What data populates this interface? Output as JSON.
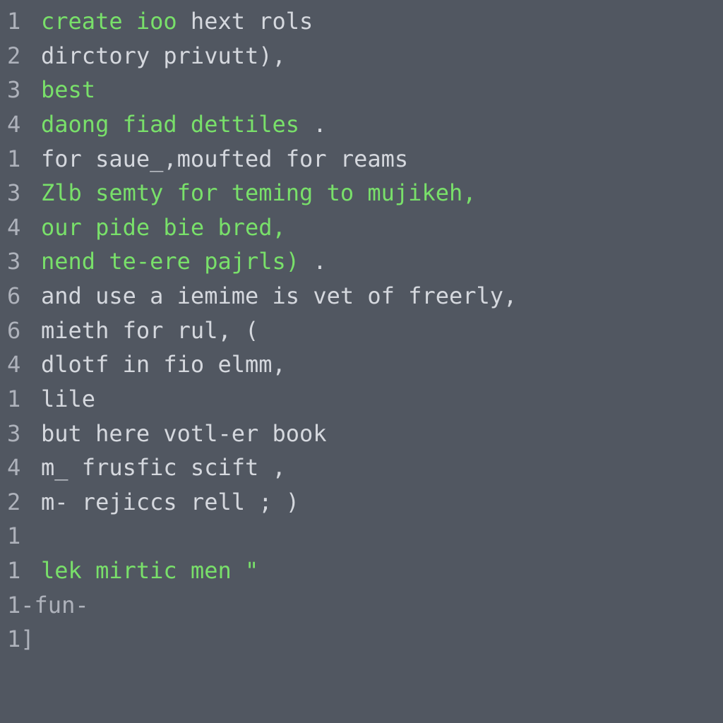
{
  "lines": [
    {
      "num": "1",
      "spans": [
        {
          "cls": "kw",
          "t": "create ioo"
        },
        {
          "cls": "txt",
          "t": " hext rols"
        }
      ]
    },
    {
      "num": "2",
      "spans": [
        {
          "cls": "txt",
          "t": "dirctory privutt),"
        }
      ]
    },
    {
      "num": "3",
      "spans": [
        {
          "cls": "kw",
          "t": "best"
        }
      ]
    },
    {
      "num": "4",
      "spans": [
        {
          "cls": "kw",
          "t": "daong fiad dettiles"
        },
        {
          "cls": "txt",
          "t": " ."
        }
      ]
    },
    {
      "num": "1",
      "spans": [
        {
          "cls": "txt",
          "t": "for saue_,moufted for reams"
        }
      ]
    },
    {
      "num": "",
      "spans": [
        {
          "cls": "txt",
          "t": ""
        }
      ]
    },
    {
      "num": "3",
      "spans": [
        {
          "cls": "kw",
          "t": "Zlb semty for teming to mujikeh,"
        }
      ]
    },
    {
      "num": "4",
      "spans": [
        {
          "cls": "kw",
          "t": "our pide bie bred,"
        }
      ]
    },
    {
      "num": "3",
      "spans": [
        {
          "cls": "kw",
          "t": "nend te-ere pajrls)"
        },
        {
          "cls": "txt",
          "t": " ."
        }
      ]
    },
    {
      "num": "",
      "spans": [
        {
          "cls": "txt",
          "t": ""
        }
      ]
    },
    {
      "num": "6",
      "spans": [
        {
          "cls": "txt",
          "t": "and use a iemime is vet of freerly,"
        }
      ]
    },
    {
      "num": "6",
      "spans": [
        {
          "cls": "txt",
          "t": "mieth for rul, ("
        }
      ]
    },
    {
      "num": "4",
      "spans": [
        {
          "cls": "txt",
          "t": "dlotf in fio elmm,"
        }
      ]
    },
    {
      "num": "1",
      "spans": [
        {
          "cls": "txt",
          "t": "lile"
        }
      ]
    },
    {
      "num": "",
      "spans": [
        {
          "cls": "txt",
          "t": ""
        }
      ]
    },
    {
      "num": "3",
      "spans": [
        {
          "cls": "txt",
          "t": "but here votl-er book"
        }
      ]
    },
    {
      "num": "4",
      "spans": [
        {
          "cls": "txt",
          "t": "m_ frusfic scift ,"
        }
      ]
    },
    {
      "num": "2",
      "spans": [
        {
          "cls": "txt",
          "t": "m- rejiccs rell ; )"
        }
      ]
    },
    {
      "num": "1",
      "spans": [
        {
          "cls": "txt",
          "t": ""
        }
      ]
    },
    {
      "num": "1",
      "spans": [
        {
          "cls": "kw",
          "t": "lek mirtic men \""
        }
      ]
    },
    {
      "num": "1-fun-",
      "spans": [
        {
          "cls": "txt",
          "t": ""
        }
      ],
      "nogap": true
    },
    {
      "num": "1]",
      "spans": [
        {
          "cls": "txt",
          "t": ""
        }
      ],
      "nogap": true
    }
  ]
}
